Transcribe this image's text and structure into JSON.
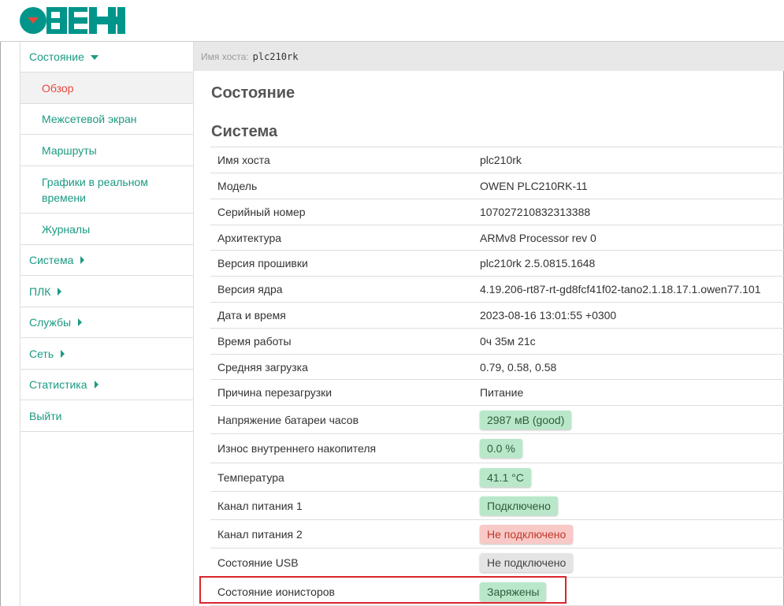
{
  "brand": {
    "logo_text": "ОВЕН",
    "logo_color": "#00958a"
  },
  "sidebar": {
    "items": [
      {
        "label": "Состояние",
        "icon": "caret-down-icon"
      },
      {
        "label": "Обзор"
      },
      {
        "label": "Межсетевой экран"
      },
      {
        "label": "Маршруты"
      },
      {
        "label": "Графики в реальном времени"
      },
      {
        "label": "Журналы"
      },
      {
        "label": "Система",
        "icon": "caret-right-icon"
      },
      {
        "label": "ПЛК",
        "icon": "caret-right-icon"
      },
      {
        "label": "Службы",
        "icon": "caret-right-icon"
      },
      {
        "label": "Сеть",
        "icon": "caret-right-icon"
      },
      {
        "label": "Статистика",
        "icon": "caret-right-icon"
      },
      {
        "label": "Выйти"
      }
    ]
  },
  "hostbar": {
    "label": "Имя хоста:",
    "value": "plc210rk"
  },
  "main": {
    "title": "Состояние",
    "section_title": "Система",
    "rows": [
      {
        "name": "Имя хоста",
        "value": "plc210rk"
      },
      {
        "name": "Модель",
        "value": "OWEN PLC210RK-11"
      },
      {
        "name": "Серийный номер",
        "value": "107027210832313388"
      },
      {
        "name": "Архитектура",
        "value": "ARMv8 Processor rev 0"
      },
      {
        "name": "Версия прошивки",
        "value": "plc210rk 2.5.0815.1648"
      },
      {
        "name": "Версия ядра",
        "value": "4.19.206-rt87-rt-gd8fcf41f02-tano2.1.18.17.1.owen77.101"
      },
      {
        "name": "Дата и время",
        "value": "2023-08-16 13:01:55 +0300"
      },
      {
        "name": "Время работы",
        "value": "0ч 35м 21с"
      },
      {
        "name": "Средняя загрузка",
        "value": "0.79, 0.58, 0.58"
      },
      {
        "name": "Причина перезагрузки",
        "value": "Питание"
      },
      {
        "name": "Напряжение батареи часов",
        "value": "2987 мВ (good)",
        "status": "good"
      },
      {
        "name": "Износ внутреннего накопителя",
        "value": "0.0 %",
        "status": "good"
      },
      {
        "name": "Температура",
        "value": "41.1 °C",
        "status": "good"
      },
      {
        "name": "Канал питания 1",
        "value": "Подключено",
        "status": "good"
      },
      {
        "name": "Канал питания 2",
        "value": "Не подключено",
        "status": "bad"
      },
      {
        "name": "Состояние USB",
        "value": "Не подключено",
        "status": "neutral"
      },
      {
        "name": "Состояние ионисторов",
        "value": "Заряжены",
        "status": "good"
      }
    ]
  },
  "colors": {
    "accent": "#1a9a82",
    "active": "#e8473c",
    "good_bg": "#b8e8c9",
    "bad_bg": "#f8c9c6",
    "neutral_bg": "#e4e4e4",
    "highlight": "#d9262c"
  }
}
